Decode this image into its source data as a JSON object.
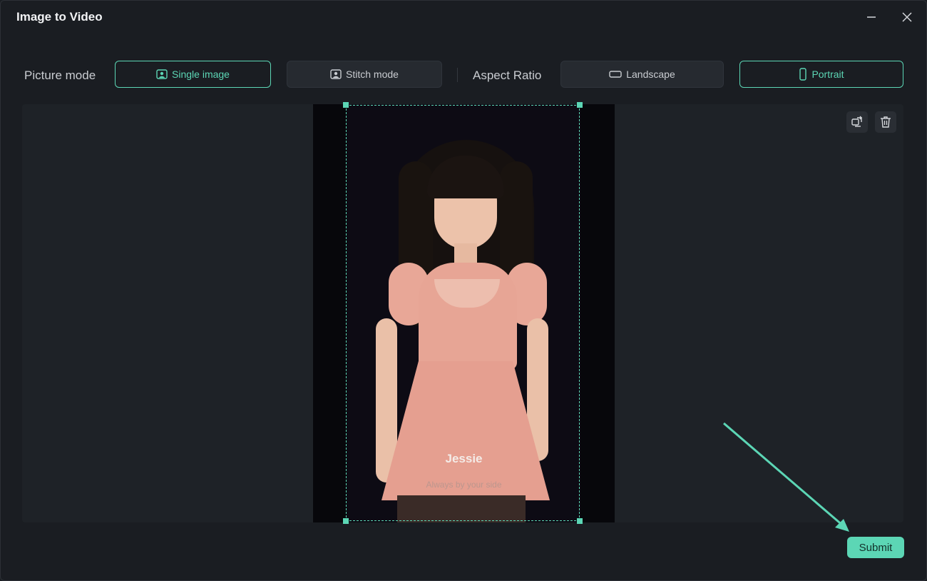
{
  "window": {
    "title": "Image to Video"
  },
  "toolbar": {
    "picture_mode_label": "Picture mode",
    "single_image_label": "Single image",
    "stitch_mode_label": "Stitch mode",
    "aspect_ratio_label": "Aspect Ratio",
    "landscape_label": "Landscape",
    "portrait_label": "Portrait",
    "selected_picture_mode": "Single image",
    "selected_aspect_ratio": "Portrait"
  },
  "preview": {
    "overlay_name": "Jessie",
    "overlay_tagline": "Always by your side",
    "icons": [
      "replace-image-icon",
      "delete-icon"
    ]
  },
  "footer": {
    "submit_label": "Submit"
  },
  "colors": {
    "accent": "#5cd6b5",
    "background": "#1a1d22",
    "panel": "#1e2227",
    "button": "#262a30"
  }
}
